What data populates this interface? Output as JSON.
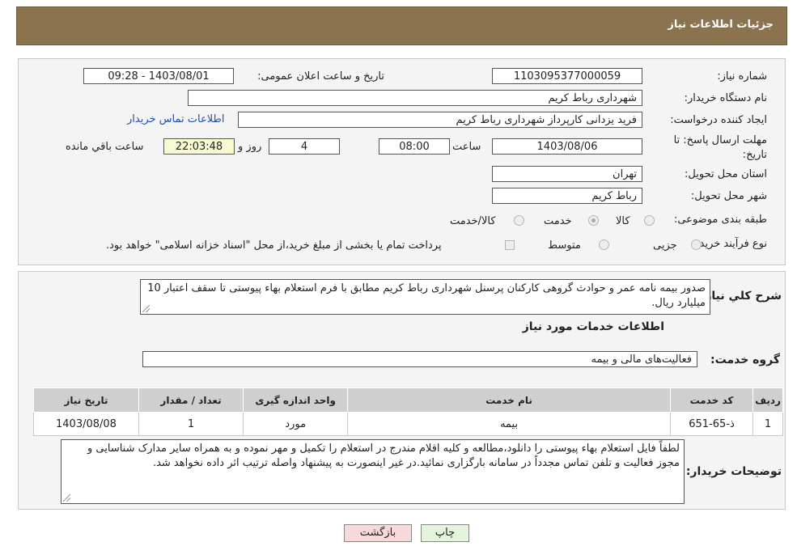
{
  "header": {
    "title": "جزئیات اطلاعات نیاز"
  },
  "fields": {
    "need_number_label": "شماره نیاز:",
    "need_number": "1103095377000059",
    "announce_label": "تاریخ و ساعت اعلان عمومی:",
    "announce_value": "1403/08/01 - 09:28",
    "buyer_name_label": "نام دستگاه خریدار:",
    "buyer_name": "شهرداری رباط کریم",
    "requester_label": "ایجاد کننده درخواست:",
    "requester": "فرید یزدانی کارپرداز شهرداری رباط کریم",
    "contact_link": "اطلاعات تماس خریدار",
    "deadline_label": "مهلت ارسال پاسخ: تا تاریخ:",
    "deadline_date": "1403/08/06",
    "time_label": "ساعت",
    "deadline_time": "08:00",
    "days_value": "4",
    "days_label": "روز و",
    "remaining_time": "22:03:48",
    "remaining_label": "ساعت باقي مانده",
    "province_label": "استان محل تحویل:",
    "province": "تهران",
    "city_label": "شهر محل تحویل:",
    "city": "رباط کریم",
    "category_label": "طبقه بندی موضوعی:",
    "category_options": [
      "کالا",
      "خدمت",
      "کالا/خدمت"
    ],
    "category_selected": "خدمت",
    "process_label": "نوع فرآیند خرید :",
    "process_options": [
      "جزیی",
      "متوسط"
    ],
    "payment_note": "پرداخت تمام یا بخشی از مبلغ خرید،از محل \"اسناد خزانه اسلامی\" خواهد بود."
  },
  "details": {
    "summary_label": "شرح کلي نياز:",
    "summary_text": "صدور بیمه نامه عمر و حوادث گروهی کارکنان پرسنل شهرداری رباط کریم مطابق با فرم استعلام بهاء پیوستی تا سقف اعتبار 10 میلیارد ریال.",
    "services_heading": "اطلاعات خدمات مورد نیاز",
    "service_group_label": "گروه خدمت:",
    "service_group": "فعالیت‌های مالی و بیمه",
    "table_headers": [
      "ردیف",
      "کد خدمت",
      "نام خدمت",
      "واحد اندازه گیری",
      "تعداد / مقدار",
      "تاریخ نیاز"
    ],
    "table_rows": [
      [
        "1",
        "ذ-65-651",
        "بیمه",
        "مورد",
        "1",
        "1403/08/08"
      ]
    ],
    "buyer_notes_label": "توضیحات خریدار:",
    "buyer_notes": "لطفاً فایل استعلام بهاء پیوستی را دانلود،مطالعه و کلیه اقلام مندرج در استعلام را تکمیل و مهر نموده و به همراه سایر مدارک شناسایی و مجوز فعالیت و تلفن تماس مجدداً در سامانه بارگزاری نمائید.در غیر اینصورت به پیشنهاد واصله ترتیب اثر داده نخواهد شد."
  },
  "buttons": {
    "print": "چاپ",
    "back": "بازگشت"
  },
  "colors": {
    "header_bg": "#8b7350",
    "back_button_bg": "#f7d9d9",
    "print_button_bg": "#e3f5dc",
    "link": "#1f4fb7"
  }
}
